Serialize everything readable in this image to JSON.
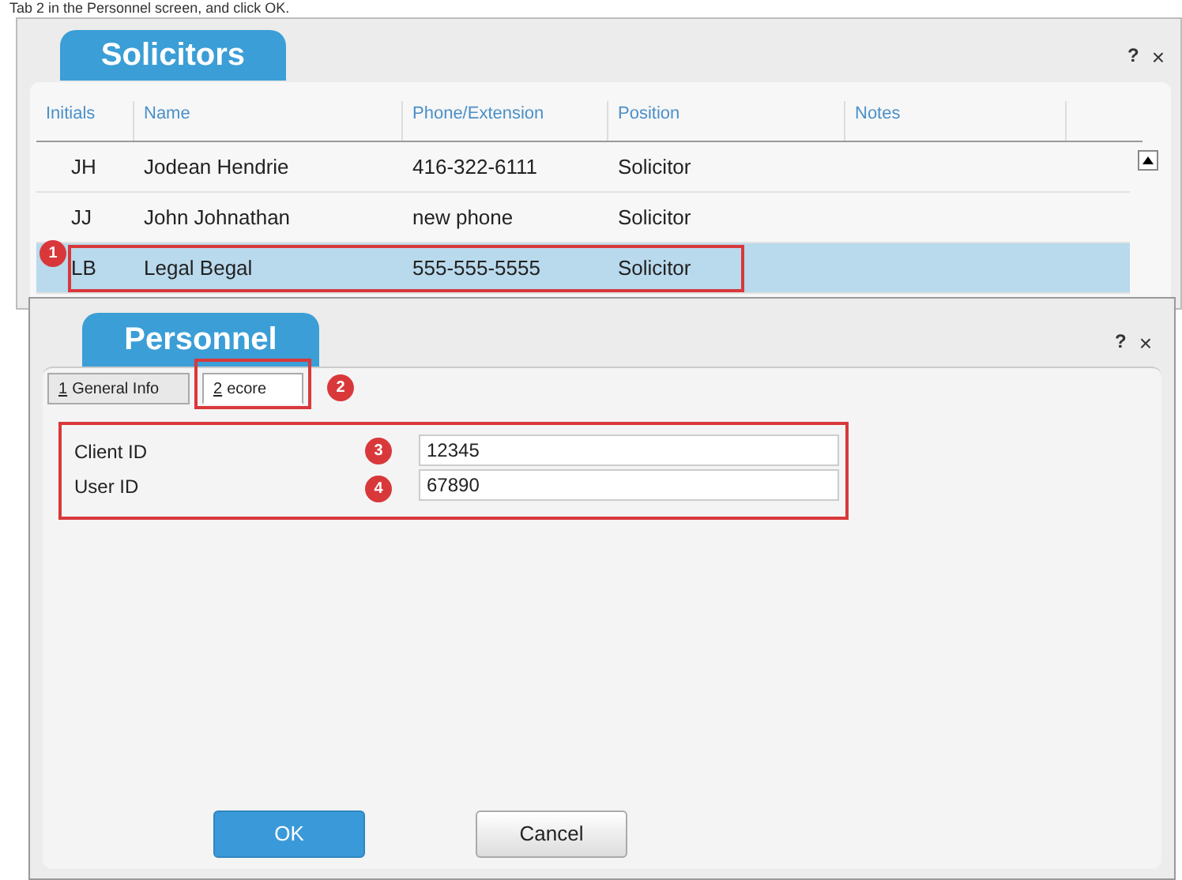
{
  "caption": "Tab 2 in the Personnel screen, and click OK.",
  "solicitors": {
    "title": "Solicitors",
    "help": "?",
    "close": "×",
    "columns": [
      "Initials",
      "Name",
      "Phone/Extension",
      "Position",
      "Notes"
    ],
    "rows": [
      {
        "cells": [
          "JH",
          "Jodean Hendrie",
          "416-322-6111",
          "Solicitor",
          ""
        ],
        "selected": false
      },
      {
        "cells": [
          "JJ",
          "John Johnathan",
          "new phone",
          "Solicitor",
          ""
        ],
        "selected": false
      },
      {
        "cells": [
          "LB",
          "Legal Begal",
          "555-555-5555",
          "Solicitor",
          ""
        ],
        "selected": true
      }
    ],
    "callout": "1"
  },
  "personnel": {
    "title": "Personnel",
    "help": "?",
    "close": "×",
    "tabs": [
      {
        "number": "1",
        "label": "General Info",
        "selected": false
      },
      {
        "number": "2",
        "label": "ecore",
        "selected": true
      }
    ],
    "tab_callout": "2",
    "fields": [
      {
        "label": "Client ID",
        "value": "12345",
        "callout": "3"
      },
      {
        "label": "User ID",
        "value": "67890",
        "callout": "4"
      }
    ],
    "buttons": [
      {
        "label": "OK",
        "kind": "primary"
      },
      {
        "label": "Cancel",
        "kind": "secondary"
      }
    ]
  }
}
